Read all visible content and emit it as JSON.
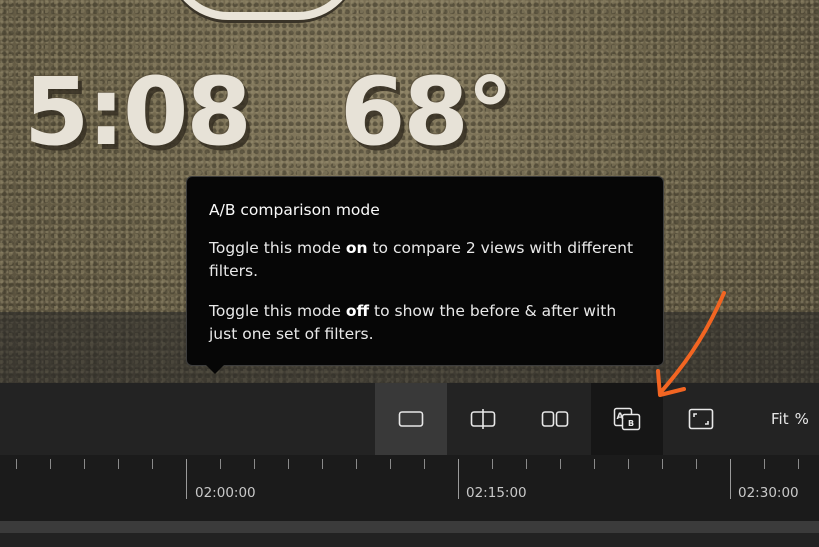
{
  "video": {
    "overlay_time": "5:08",
    "overlay_temp": "68°"
  },
  "tooltip": {
    "title": "A/B comparison mode",
    "p1_before": "Toggle this mode ",
    "p1_bold": "on",
    "p1_after": " to compare 2 views with different filters.",
    "p2_before": "Toggle this mode ",
    "p2_bold": "off",
    "p2_after": " to show the before & after with just one set of filters."
  },
  "toolbar": {
    "buttons": [
      {
        "icon": "single-view-icon",
        "active": true
      },
      {
        "icon": "split-view-icon",
        "active": false
      },
      {
        "icon": "side-by-side-icon",
        "active": false
      },
      {
        "icon": "ab-compare-icon",
        "active": false
      },
      {
        "icon": "fit-frame-icon",
        "active": false
      }
    ],
    "zoom_label": "Fit",
    "zoom_unit": "%"
  },
  "timeline": {
    "labels": [
      "02:00:00",
      "02:15:00",
      "02:30:00"
    ]
  },
  "annotation": {
    "arrow_color": "#f26522"
  }
}
